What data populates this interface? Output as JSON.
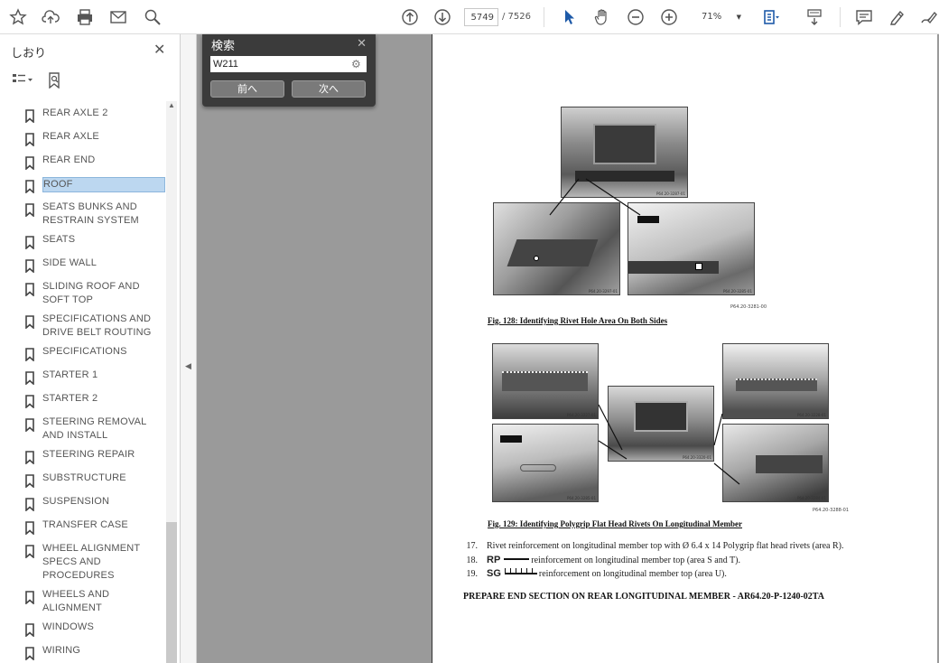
{
  "toolbar": {
    "current_page": "5749",
    "total_pages": "/ 7526",
    "zoom": "71%"
  },
  "sidebar": {
    "title": "しおり",
    "bookmarks": [
      {
        "label": "REAR AXLE  2"
      },
      {
        "label": "REAR AXLE"
      },
      {
        "label": "REAR END"
      },
      {
        "label": "ROOF"
      },
      {
        "label": "SEATS BUNKS AND RESTRAIN SYSTEM"
      },
      {
        "label": "SEATS"
      },
      {
        "label": "SIDE WALL"
      },
      {
        "label": "SLIDING ROOF AND SOFT TOP"
      },
      {
        "label": "SPECIFICATIONS AND DRIVE BELT ROUTING"
      },
      {
        "label": "SPECIFICATIONS"
      },
      {
        "label": "STARTER 1"
      },
      {
        "label": "STARTER 2"
      },
      {
        "label": "STEERING REMOVAL AND INSTALL"
      },
      {
        "label": "STEERING REPAIR"
      },
      {
        "label": "SUBSTRUCTURE"
      },
      {
        "label": "SUSPENSION"
      },
      {
        "label": "TRANSFER CASE"
      },
      {
        "label": "WHEEL ALIGNMENT SPECS AND PROCEDURES"
      },
      {
        "label": "WHEELS AND ALIGNMENT"
      },
      {
        "label": "WINDOWS"
      },
      {
        "label": "WIRING"
      }
    ],
    "selected_index": 3
  },
  "search": {
    "title": "検索",
    "query": "W211",
    "prev_label": "前へ",
    "next_label": "次へ"
  },
  "document": {
    "fig128_refs": [
      "P64.20-3287-01",
      "P64.20-3297-01",
      "P64.20-3285-01",
      "P64.20-3281-00"
    ],
    "fig128_caption": "Fig. 128: Identifying Rivet Hole Area On Both Sides",
    "fig129_refs": [
      "P64.20-3227-01",
      "P64.20-3285-01",
      "P64.20-3320-01",
      "P64.20-3228-01",
      "P64.20-3284-01",
      "P64.20-3288-01"
    ],
    "fig129_caption": "Fig. 129: Identifying Polygrip Flat Head Rivets On Longitudinal Member",
    "steps": [
      {
        "num": "17.",
        "symbol": "",
        "text": "Rivet reinforcement on longitudinal member top with Ø 6.4 x 14 Polygrip flat head rivets (area R)."
      },
      {
        "num": "18.",
        "symbol": "RP",
        "text": "reinforcement on longitudinal member top (area S and T)."
      },
      {
        "num": "19.",
        "symbol": "SG",
        "text": "reinforcement on longitudinal member top (area U)."
      }
    ],
    "heading": "PREPARE END SECTION ON REAR LONGITUDINAL MEMBER - AR64.20-P-1240-02TA"
  }
}
